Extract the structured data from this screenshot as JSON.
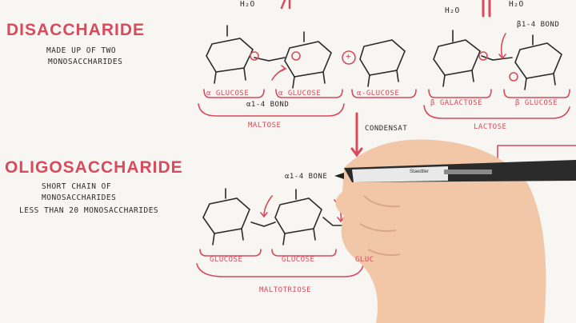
{
  "top": {
    "water_left": "H₂O",
    "water_right_1": "H₂O",
    "water_right_2": "H₂O"
  },
  "disaccharide": {
    "heading": "DISACCHARIDE",
    "desc_line1": "MADE UP OF TWO",
    "desc_line2": "MONOSACCHARIDES",
    "bond_label": "α1-4 BOND",
    "plus": "+",
    "groups": [
      {
        "name": "MALTOSE",
        "units": [
          "α GLUCOSE",
          "α GLUCOSE",
          "α-GLUCOSE"
        ]
      },
      {
        "name": "LACTOSE",
        "units": [
          "β GALACTOSE",
          "β GLUCOSE"
        ]
      }
    ],
    "lactose_bond": "β1-4 BOND",
    "condensation": "CONDENSAT"
  },
  "oligosaccharide": {
    "heading": "OLIGOSACCHARIDE",
    "desc_line1": "SHORT CHAIN OF",
    "desc_line2": "MONOSACCHARIDES",
    "desc_line3": "LESS THAN 20 MONOSACCHARIDES",
    "bond_label": "α1-4 BONE",
    "units": [
      "GLUCOSE",
      "GLUCOSE",
      "GLUC"
    ],
    "group_name": "MALTOTRIOSE"
  },
  "pen": {
    "brand": "Staedtler"
  },
  "colors": {
    "accent_red": "#d84a5c",
    "ink": "#2a2a2a",
    "paper": "#f7f6f2"
  }
}
